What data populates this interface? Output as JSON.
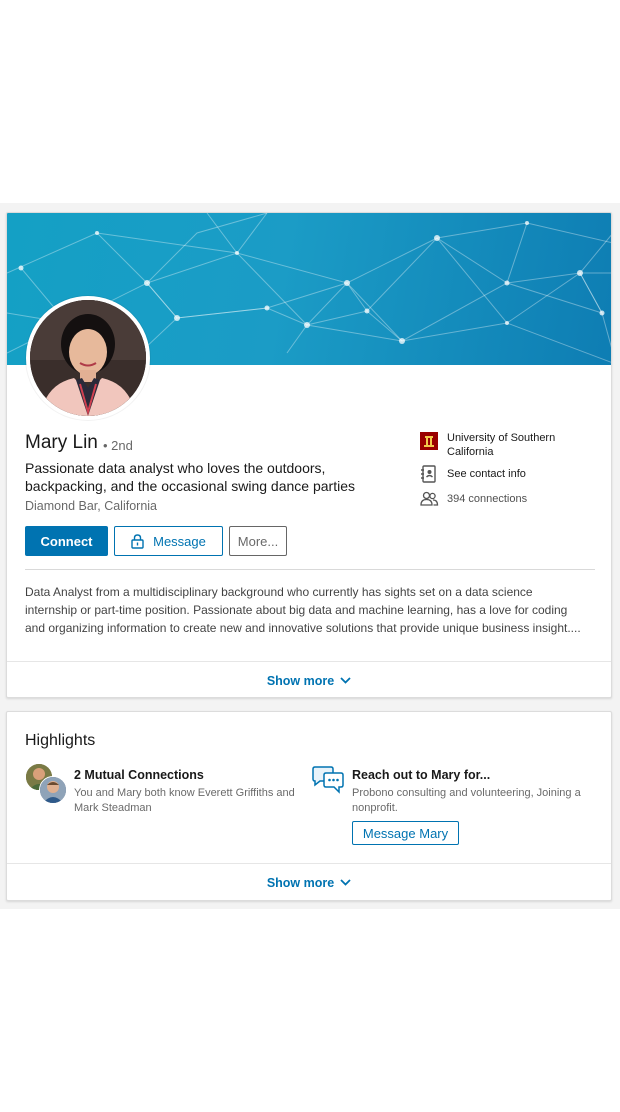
{
  "profile": {
    "name": "Mary Lin",
    "degree": "• 2nd",
    "headline": "Passionate data analyst who loves the outdoors, backpacking, and the occasional swing dance parties",
    "location": "Diamond Bar, California",
    "education": "University of Southern California",
    "contact_info": "See contact info",
    "connections": "394 connections",
    "summary_lines": [
      "Data Analyst from a multidisciplinary background who currently has sights set on a data science",
      "internship or part-time position. Passionate about big data and machine learning, has a love for coding",
      "and organizing information to create new and innovative solutions that provide unique business insight...."
    ],
    "show_more": "Show more"
  },
  "actions": {
    "connect": "Connect",
    "message": "Message",
    "more": "More..."
  },
  "highlights": {
    "title": "Highlights",
    "mutual": {
      "title": "2 Mutual Connections",
      "text": "You and Mary both know Everett Griffiths and Mark Steadman"
    },
    "reach_out": {
      "title": "Reach out to Mary for...",
      "text": "Probono consulting and volunteering, Joining a nonprofit.",
      "button": "Message Mary"
    },
    "show_more": "Show more"
  },
  "colors": {
    "accent": "#0073b1",
    "cover": "#14a0c5",
    "school": "#990000"
  },
  "icons": {
    "school": "usc-logo-icon",
    "contact": "contact-book-icon",
    "connections": "people-icon",
    "lock": "lock-icon",
    "chevron": "chevron-down-icon",
    "chat": "chat-bubbles-icon"
  }
}
